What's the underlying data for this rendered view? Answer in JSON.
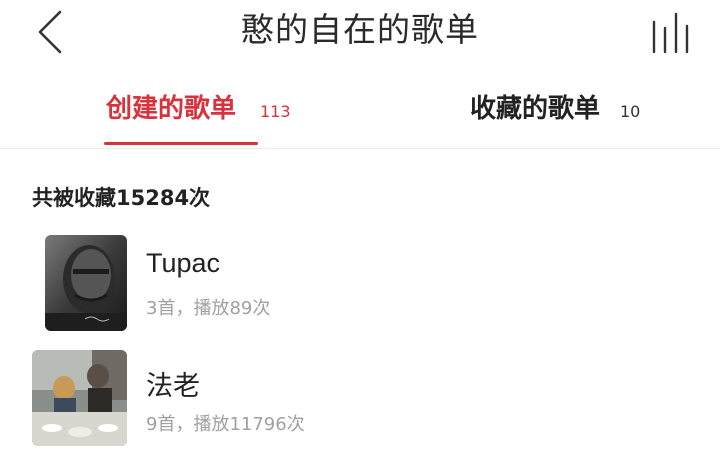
{
  "header": {
    "title": "憨的自在的歌单",
    "back_icon": "chevron-left-icon",
    "menu_icon": "bars-icon"
  },
  "tabs": [
    {
      "label": "创建的歌单",
      "count": "113",
      "active": true
    },
    {
      "label": "收藏的歌单",
      "count": "10",
      "active": false
    }
  ],
  "summary": "共被收藏15284次",
  "playlists": [
    {
      "title": "Tupac",
      "meta": "3首，播放89次"
    },
    {
      "title": "法老",
      "meta": "9首，播放11796次"
    }
  ],
  "colors": {
    "accent": "#d8323c",
    "text": "#222222",
    "muted": "#a0a0a0",
    "divider": "#ececec"
  }
}
